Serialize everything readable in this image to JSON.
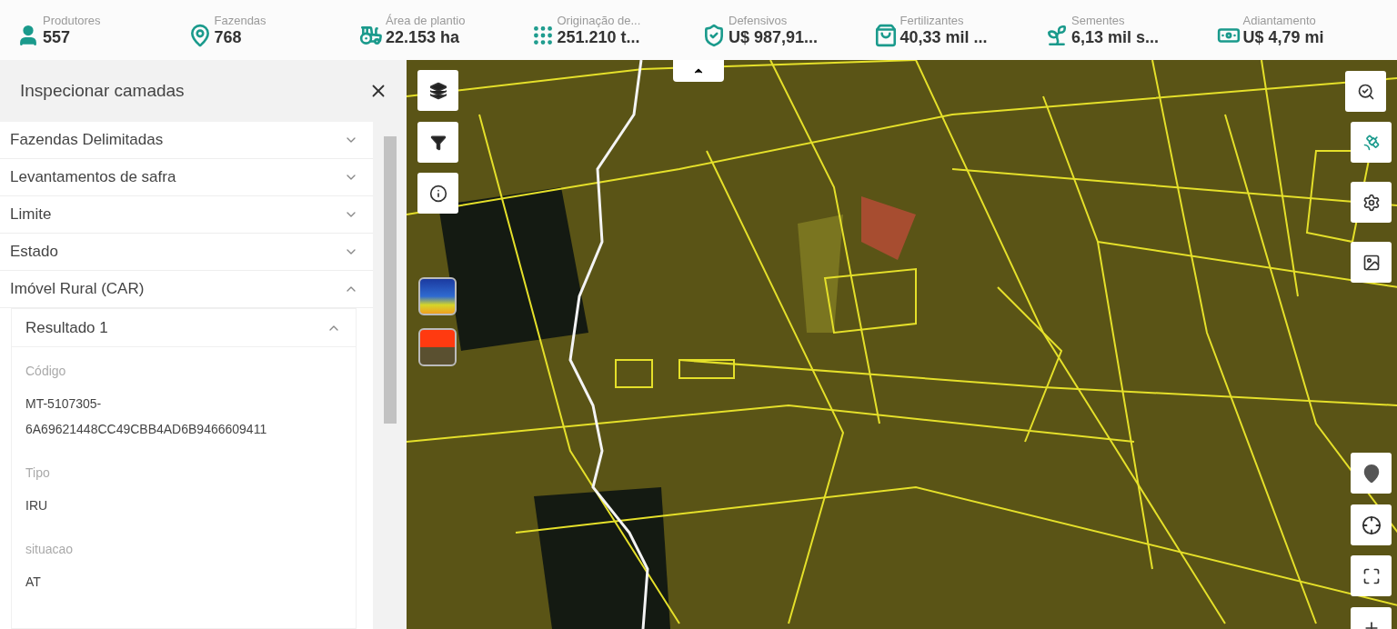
{
  "stats": [
    {
      "kind": "person",
      "label": "Produtores",
      "value": "557"
    },
    {
      "kind": "pin",
      "label": "Fazendas",
      "value": "768"
    },
    {
      "kind": "tractor",
      "label": "Área de plantio",
      "value": "22.153 ha"
    },
    {
      "kind": "dots",
      "label": "Originação de...",
      "value": "251.210 t..."
    },
    {
      "kind": "shield",
      "label": "Defensivos",
      "value": "U$ 987,91..."
    },
    {
      "kind": "bag",
      "label": "Fertilizantes",
      "value": "40,33 mil ..."
    },
    {
      "kind": "sprout",
      "label": "Sementes",
      "value": "6,13 mil s..."
    },
    {
      "kind": "money",
      "label": "Adiantamento",
      "value": "U$ 4,79 mi"
    }
  ],
  "panel": {
    "title": "Inspecionar camadas",
    "sections": [
      {
        "label": "Fazendas Delimitadas",
        "expanded": false
      },
      {
        "label": "Levantamentos de safra",
        "expanded": false
      },
      {
        "label": "Limite",
        "expanded": false
      },
      {
        "label": "Estado",
        "expanded": false
      },
      {
        "label": "Imóvel Rural (CAR)",
        "expanded": true
      }
    ],
    "result": {
      "title": "Resultado 1",
      "expanded": true,
      "fields": [
        {
          "label": "Código",
          "value": "MT-5107305-6A69621448CC49CBB4AD6B9466609411"
        },
        {
          "label": "Tipo",
          "value": "IRU"
        },
        {
          "label": "situacao",
          "value": "AT"
        }
      ]
    }
  }
}
